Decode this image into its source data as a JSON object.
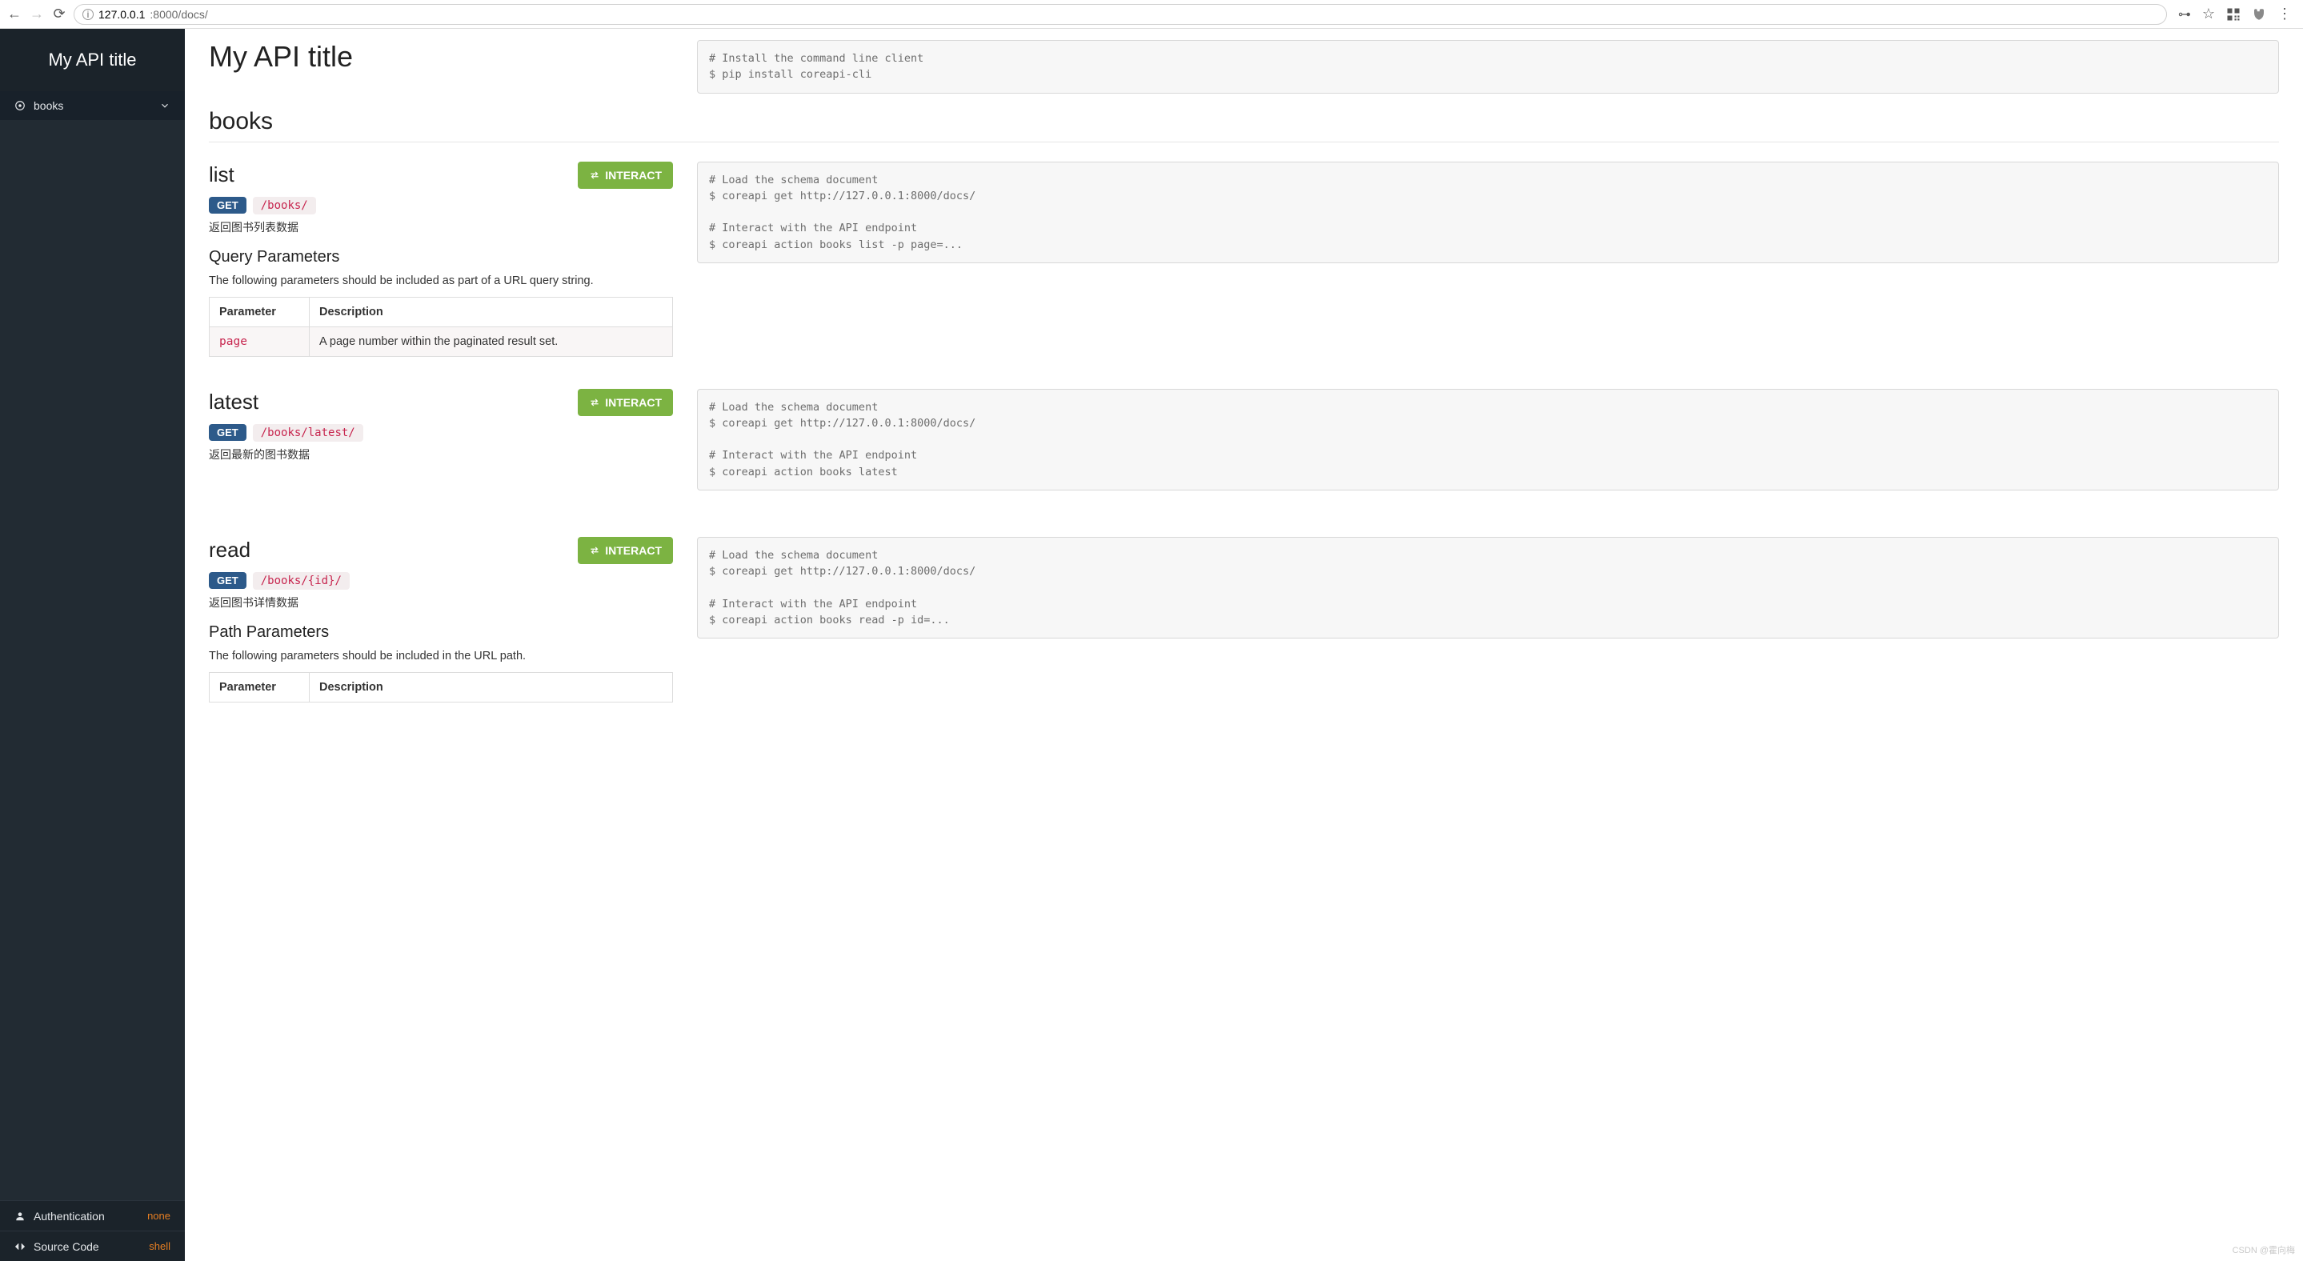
{
  "browser": {
    "url_host": "127.0.0.1",
    "url_rest": ":8000/docs/"
  },
  "sidebar": {
    "title": "My API title",
    "nav": {
      "label": "books"
    },
    "auth": {
      "label": "Authentication",
      "value": "none"
    },
    "source": {
      "label": "Source Code",
      "value": "shell"
    }
  },
  "page": {
    "title": "My API title",
    "section": "books"
  },
  "install_box": "# Install the command line client\n$ pip install coreapi-cli",
  "interact_label": "INTERACT",
  "param_head": {
    "param": "Parameter",
    "desc": "Description"
  },
  "endpoints": [
    {
      "key": "list",
      "name": "list",
      "method": "GET",
      "path": "/books/",
      "desc": "返回图书列表数据",
      "params_title": "Query Parameters",
      "params_note": "The following parameters should be included as part of a URL query string.",
      "params": [
        {
          "name": "page",
          "desc": "A page number within the paginated result set."
        }
      ],
      "code": "# Load the schema document\n$ coreapi get http://127.0.0.1:8000/docs/\n\n# Interact with the API endpoint\n$ coreapi action books list -p page=..."
    },
    {
      "key": "latest",
      "name": "latest",
      "method": "GET",
      "path": "/books/latest/",
      "desc": "返回最新的图书数据",
      "code": "# Load the schema document\n$ coreapi get http://127.0.0.1:8000/docs/\n\n# Interact with the API endpoint\n$ coreapi action books latest"
    },
    {
      "key": "read",
      "name": "read",
      "method": "GET",
      "path": "/books/{id}/",
      "desc": "返回图书详情数据",
      "params_title": "Path Parameters",
      "params_note": "The following parameters should be included in the URL path.",
      "params": [],
      "code": "# Load the schema document\n$ coreapi get http://127.0.0.1:8000/docs/\n\n# Interact with the API endpoint\n$ coreapi action books read -p id=..."
    }
  ],
  "watermark": "CSDN @霍向梅"
}
